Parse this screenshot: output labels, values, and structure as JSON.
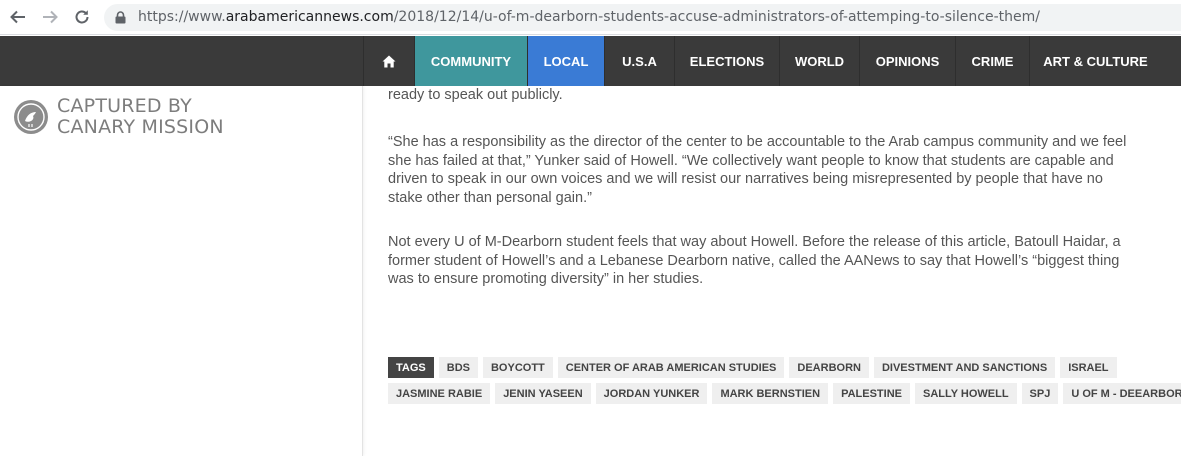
{
  "browser": {
    "url_host_prefix": "https://www.",
    "url_host": "arabamericannews.com",
    "url_path": "/2018/12/14/u-of-m-dearborn-students-accuse-administrators-of-attemping-to-silence-them/"
  },
  "nav": {
    "home_icon": "home-icon",
    "items": [
      "COMMUNITY",
      "LOCAL",
      "U.S.A",
      "ELECTIONS",
      "WORLD",
      "OPINIONS",
      "CRIME",
      "ART & CULTURE"
    ],
    "active_colors": {
      "community": "#3f979d",
      "local": "#3a7bd5"
    }
  },
  "sidebar": {
    "watermark_line1": "CAPTURED BY",
    "watermark_line2": "CANARY MISSION"
  },
  "article": {
    "p0": "ready to speak out publicly.",
    "p1": [
      "“She has a responsibility as the director of the center to be accountable to the Arab campus community and we feel",
      "she has failed at that,” Yunker said of Howell. “We collectively want people to know that students are capable and",
      "driven to speak in our own voices and we will resist our narratives being misrepresented by people that have no",
      "stake other than personal gain.”"
    ],
    "p2": [
      "Not every U of M-Dearborn student feels that way about Howell. Before the release of this article, Batoull Haidar, a",
      "former student of Howell’s and a Lebanese Dearborn native, called the AANews to say that Howell’s “biggest thing",
      "was to ensure promoting diversity” in her studies."
    ]
  },
  "tags": {
    "label": "TAGS",
    "row1": [
      "BDS",
      "BOYCOTT",
      "CENTER OF ARAB AMERICAN STUDIES",
      "DEARBORN",
      "DIVESTMENT AND SANCTIONS",
      "ISRAEL"
    ],
    "row2": [
      "JASMINE RABIE",
      "JENIN YASEEN",
      "JORDAN YUNKER",
      "MARK BERNSTIEN",
      "PALESTINE",
      "SALLY HOWELL",
      "SPJ",
      "U OF M - DEEARBORN"
    ]
  }
}
